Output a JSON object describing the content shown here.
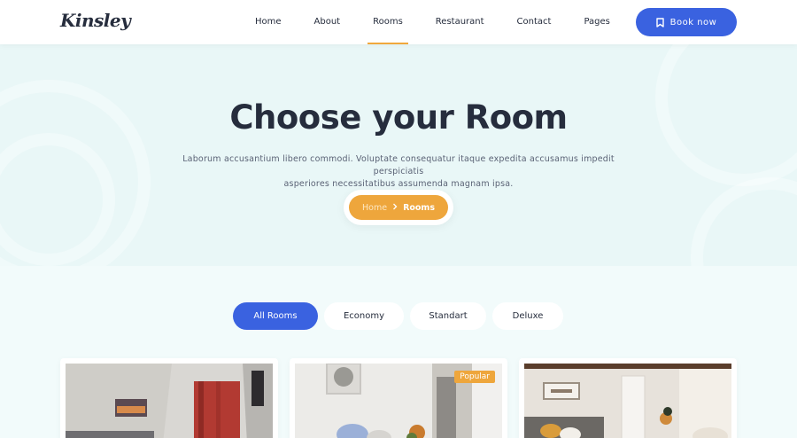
{
  "header": {
    "logo": "Kinsley",
    "nav": [
      {
        "label": "Home",
        "active": false
      },
      {
        "label": "About",
        "active": false
      },
      {
        "label": "Rooms",
        "active": true
      },
      {
        "label": "Restaurant",
        "active": false
      },
      {
        "label": "Contact",
        "active": false
      },
      {
        "label": "Pages",
        "active": false
      }
    ],
    "book_label": "Book now"
  },
  "hero": {
    "title": "Choose your Room",
    "subtitle_line1": "Laborum accusantium libero commodi. Voluptate consequatur itaque expedita accusamus impedit perspiciatis",
    "subtitle_line2": "asperiores necessitatibus assumenda magnam ipsa.",
    "breadcrumb": {
      "home": "Home",
      "current": "Rooms"
    }
  },
  "filters": [
    {
      "label": "All Rooms",
      "active": true
    },
    {
      "label": "Economy",
      "active": false
    },
    {
      "label": "Standart",
      "active": false
    },
    {
      "label": "Deluxe",
      "active": false
    }
  ],
  "rooms": [
    {
      "badge": ""
    },
    {
      "badge": "Popular"
    },
    {
      "badge": ""
    }
  ],
  "colors": {
    "accent_blue": "#3a62e0",
    "accent_orange": "#eea63c",
    "text_dark": "#262d3d",
    "hero_bg": "#e9f7f7"
  }
}
